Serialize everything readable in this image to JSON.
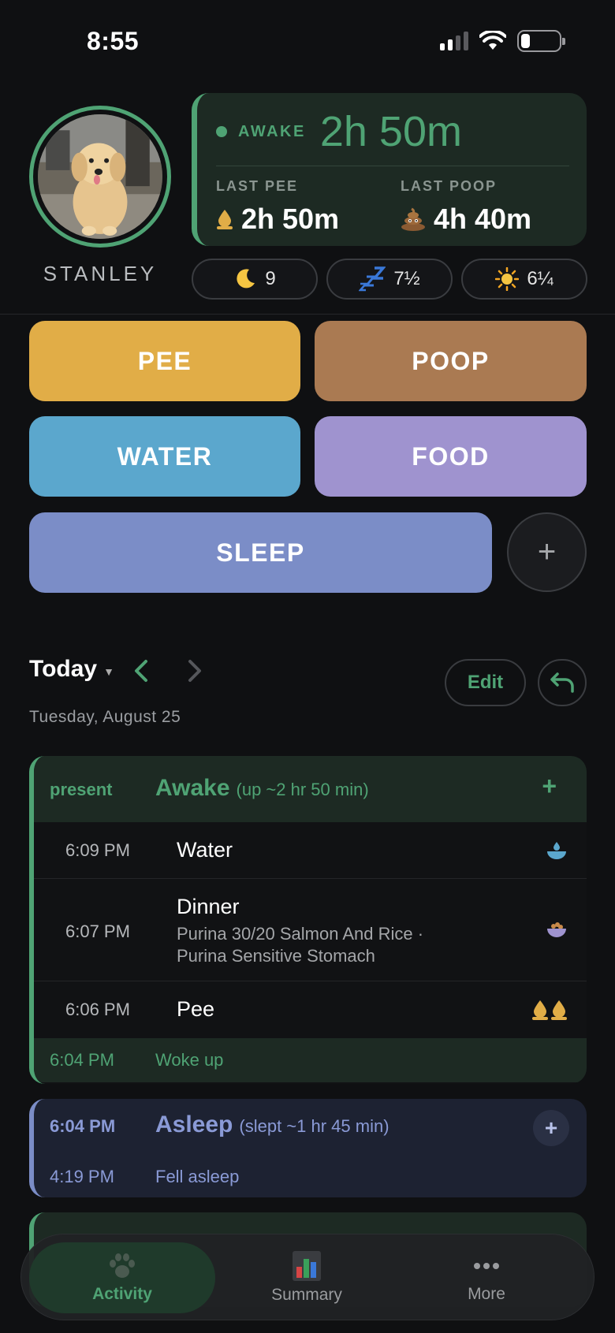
{
  "status_bar": {
    "time": "8:55"
  },
  "profile": {
    "name": "STANLEY"
  },
  "awake_card": {
    "state_label": "AWAKE",
    "duration": "2h 50m",
    "last_pee_label": "LAST PEE",
    "last_pee_value": "2h 50m",
    "last_poop_label": "LAST POOP",
    "last_poop_value": "4h 40m"
  },
  "pills": [
    {
      "icon": "moon-icon",
      "value": "9"
    },
    {
      "icon": "zzz-icon",
      "value": "7½"
    },
    {
      "icon": "sun-icon",
      "value": "6¼"
    }
  ],
  "actions": {
    "pee": "PEE",
    "poop": "POOP",
    "water": "WATER",
    "food": "FOOD",
    "sleep": "SLEEP",
    "add": "+"
  },
  "day_nav": {
    "today": "Today",
    "date": "Tuesday, August 25",
    "edit": "Edit"
  },
  "awake_block": {
    "present": "present",
    "title": "Awake",
    "subtitle": "(up ~2 hr 50 min)",
    "plus": "+",
    "events": [
      {
        "time": "6:09 PM",
        "title": "Water",
        "subtitle": "",
        "icon": "water-bowl-icon"
      },
      {
        "time": "6:07 PM",
        "title": "Dinner",
        "subtitle_line1": "Purina 30/20 Salmon And Rice ·",
        "subtitle_line2": "Purina Sensitive Stomach",
        "icon": "food-bowl-icon"
      },
      {
        "time": "6:06 PM",
        "title": "Pee",
        "subtitle": "",
        "icon": "double-drop-icon"
      }
    ],
    "woke_time": "6:04 PM",
    "woke_label": "Woke up"
  },
  "asleep_block": {
    "time_end": "6:04 PM",
    "title": "Asleep",
    "subtitle": "(slept ~1 hr 45 min)",
    "plus": "+",
    "time_start": "4:19 PM",
    "start_label": "Fell asleep"
  },
  "tabs": [
    {
      "label": "Activity",
      "icon": "paw-icon",
      "active": true
    },
    {
      "label": "Summary",
      "icon": "bar-chart-icon",
      "active": false
    },
    {
      "label": "More",
      "icon": "ellipsis-icon",
      "active": false
    }
  ],
  "colors": {
    "accent_green": "#4fa374",
    "pee": "#e1ad47",
    "poop": "#aa7a52",
    "water": "#5ba7cd",
    "food": "#9f93cf",
    "sleep": "#7b8dc7"
  }
}
